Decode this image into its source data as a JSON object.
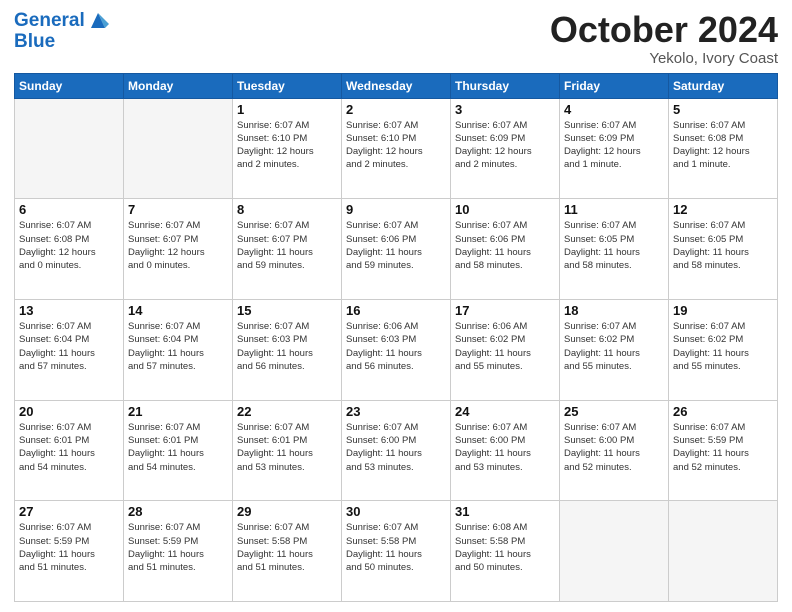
{
  "header": {
    "logo_line1": "General",
    "logo_line2": "Blue",
    "month": "October 2024",
    "location": "Yekolo, Ivory Coast"
  },
  "weekdays": [
    "Sunday",
    "Monday",
    "Tuesday",
    "Wednesday",
    "Thursday",
    "Friday",
    "Saturday"
  ],
  "weeks": [
    [
      {
        "day": "",
        "info": ""
      },
      {
        "day": "",
        "info": ""
      },
      {
        "day": "1",
        "info": "Sunrise: 6:07 AM\nSunset: 6:10 PM\nDaylight: 12 hours\nand 2 minutes."
      },
      {
        "day": "2",
        "info": "Sunrise: 6:07 AM\nSunset: 6:10 PM\nDaylight: 12 hours\nand 2 minutes."
      },
      {
        "day": "3",
        "info": "Sunrise: 6:07 AM\nSunset: 6:09 PM\nDaylight: 12 hours\nand 2 minutes."
      },
      {
        "day": "4",
        "info": "Sunrise: 6:07 AM\nSunset: 6:09 PM\nDaylight: 12 hours\nand 1 minute."
      },
      {
        "day": "5",
        "info": "Sunrise: 6:07 AM\nSunset: 6:08 PM\nDaylight: 12 hours\nand 1 minute."
      }
    ],
    [
      {
        "day": "6",
        "info": "Sunrise: 6:07 AM\nSunset: 6:08 PM\nDaylight: 12 hours\nand 0 minutes."
      },
      {
        "day": "7",
        "info": "Sunrise: 6:07 AM\nSunset: 6:07 PM\nDaylight: 12 hours\nand 0 minutes."
      },
      {
        "day": "8",
        "info": "Sunrise: 6:07 AM\nSunset: 6:07 PM\nDaylight: 11 hours\nand 59 minutes."
      },
      {
        "day": "9",
        "info": "Sunrise: 6:07 AM\nSunset: 6:06 PM\nDaylight: 11 hours\nand 59 minutes."
      },
      {
        "day": "10",
        "info": "Sunrise: 6:07 AM\nSunset: 6:06 PM\nDaylight: 11 hours\nand 58 minutes."
      },
      {
        "day": "11",
        "info": "Sunrise: 6:07 AM\nSunset: 6:05 PM\nDaylight: 11 hours\nand 58 minutes."
      },
      {
        "day": "12",
        "info": "Sunrise: 6:07 AM\nSunset: 6:05 PM\nDaylight: 11 hours\nand 58 minutes."
      }
    ],
    [
      {
        "day": "13",
        "info": "Sunrise: 6:07 AM\nSunset: 6:04 PM\nDaylight: 11 hours\nand 57 minutes."
      },
      {
        "day": "14",
        "info": "Sunrise: 6:07 AM\nSunset: 6:04 PM\nDaylight: 11 hours\nand 57 minutes."
      },
      {
        "day": "15",
        "info": "Sunrise: 6:07 AM\nSunset: 6:03 PM\nDaylight: 11 hours\nand 56 minutes."
      },
      {
        "day": "16",
        "info": "Sunrise: 6:06 AM\nSunset: 6:03 PM\nDaylight: 11 hours\nand 56 minutes."
      },
      {
        "day": "17",
        "info": "Sunrise: 6:06 AM\nSunset: 6:02 PM\nDaylight: 11 hours\nand 55 minutes."
      },
      {
        "day": "18",
        "info": "Sunrise: 6:07 AM\nSunset: 6:02 PM\nDaylight: 11 hours\nand 55 minutes."
      },
      {
        "day": "19",
        "info": "Sunrise: 6:07 AM\nSunset: 6:02 PM\nDaylight: 11 hours\nand 55 minutes."
      }
    ],
    [
      {
        "day": "20",
        "info": "Sunrise: 6:07 AM\nSunset: 6:01 PM\nDaylight: 11 hours\nand 54 minutes."
      },
      {
        "day": "21",
        "info": "Sunrise: 6:07 AM\nSunset: 6:01 PM\nDaylight: 11 hours\nand 54 minutes."
      },
      {
        "day": "22",
        "info": "Sunrise: 6:07 AM\nSunset: 6:01 PM\nDaylight: 11 hours\nand 53 minutes."
      },
      {
        "day": "23",
        "info": "Sunrise: 6:07 AM\nSunset: 6:00 PM\nDaylight: 11 hours\nand 53 minutes."
      },
      {
        "day": "24",
        "info": "Sunrise: 6:07 AM\nSunset: 6:00 PM\nDaylight: 11 hours\nand 53 minutes."
      },
      {
        "day": "25",
        "info": "Sunrise: 6:07 AM\nSunset: 6:00 PM\nDaylight: 11 hours\nand 52 minutes."
      },
      {
        "day": "26",
        "info": "Sunrise: 6:07 AM\nSunset: 5:59 PM\nDaylight: 11 hours\nand 52 minutes."
      }
    ],
    [
      {
        "day": "27",
        "info": "Sunrise: 6:07 AM\nSunset: 5:59 PM\nDaylight: 11 hours\nand 51 minutes."
      },
      {
        "day": "28",
        "info": "Sunrise: 6:07 AM\nSunset: 5:59 PM\nDaylight: 11 hours\nand 51 minutes."
      },
      {
        "day": "29",
        "info": "Sunrise: 6:07 AM\nSunset: 5:58 PM\nDaylight: 11 hours\nand 51 minutes."
      },
      {
        "day": "30",
        "info": "Sunrise: 6:07 AM\nSunset: 5:58 PM\nDaylight: 11 hours\nand 50 minutes."
      },
      {
        "day": "31",
        "info": "Sunrise: 6:08 AM\nSunset: 5:58 PM\nDaylight: 11 hours\nand 50 minutes."
      },
      {
        "day": "",
        "info": ""
      },
      {
        "day": "",
        "info": ""
      }
    ]
  ]
}
